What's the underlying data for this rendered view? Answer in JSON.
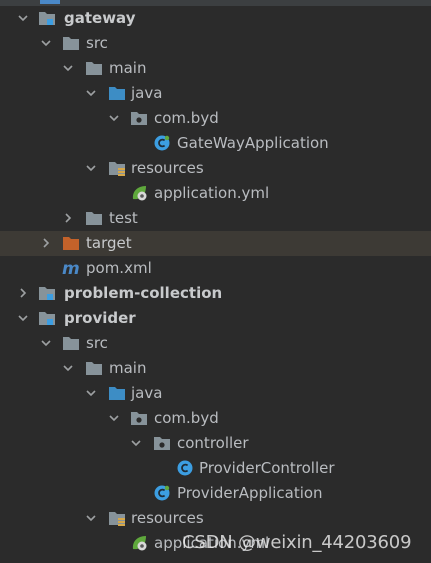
{
  "colors": {
    "background": "#2b2b2b",
    "text": "#b9bcc0",
    "folder": "#87939a",
    "source_folder": "#3d8dc5",
    "excluded_folder": "#c3622a",
    "java_class": "#3c9ee2",
    "spring": "#5fa83c",
    "highlight_row": "#3d3a35"
  },
  "tree": {
    "items": [
      {
        "label": "gateway",
        "icon": "module-icon",
        "expanded": true,
        "bold": true
      },
      {
        "label": "src",
        "icon": "folder-icon",
        "expanded": true
      },
      {
        "label": "main",
        "icon": "folder-icon",
        "expanded": true
      },
      {
        "label": "java",
        "icon": "source-folder-icon",
        "expanded": true
      },
      {
        "label": "com.byd",
        "icon": "package-icon",
        "expanded": true
      },
      {
        "label": "GateWayApplication",
        "icon": "java-class-icon"
      },
      {
        "label": "resources",
        "icon": "resources-folder-icon",
        "expanded": true
      },
      {
        "label": "application.yml",
        "icon": "spring-config-icon"
      },
      {
        "label": "test",
        "icon": "folder-icon",
        "expanded": false
      },
      {
        "label": "target",
        "icon": "excluded-folder-icon",
        "expanded": false
      },
      {
        "label": "pom.xml",
        "icon": "maven-icon"
      },
      {
        "label": "problem-collection",
        "icon": "module-icon",
        "expanded": false,
        "bold": true
      },
      {
        "label": "provider",
        "icon": "module-icon",
        "expanded": true,
        "bold": true
      },
      {
        "label": "src",
        "icon": "folder-icon",
        "expanded": true
      },
      {
        "label": "main",
        "icon": "folder-icon",
        "expanded": true
      },
      {
        "label": "java",
        "icon": "source-folder-icon",
        "expanded": true
      },
      {
        "label": "com.byd",
        "icon": "package-icon",
        "expanded": true
      },
      {
        "label": "controller",
        "icon": "package-icon",
        "expanded": true
      },
      {
        "label": "ProviderController",
        "icon": "java-class-icon"
      },
      {
        "label": "ProviderApplication",
        "icon": "java-class-icon"
      },
      {
        "label": "resources",
        "icon": "resources-folder-icon",
        "expanded": true
      },
      {
        "label": "application.yml",
        "icon": "spring-config-icon"
      }
    ]
  },
  "watermark": "CSDN @weixin_44203609"
}
